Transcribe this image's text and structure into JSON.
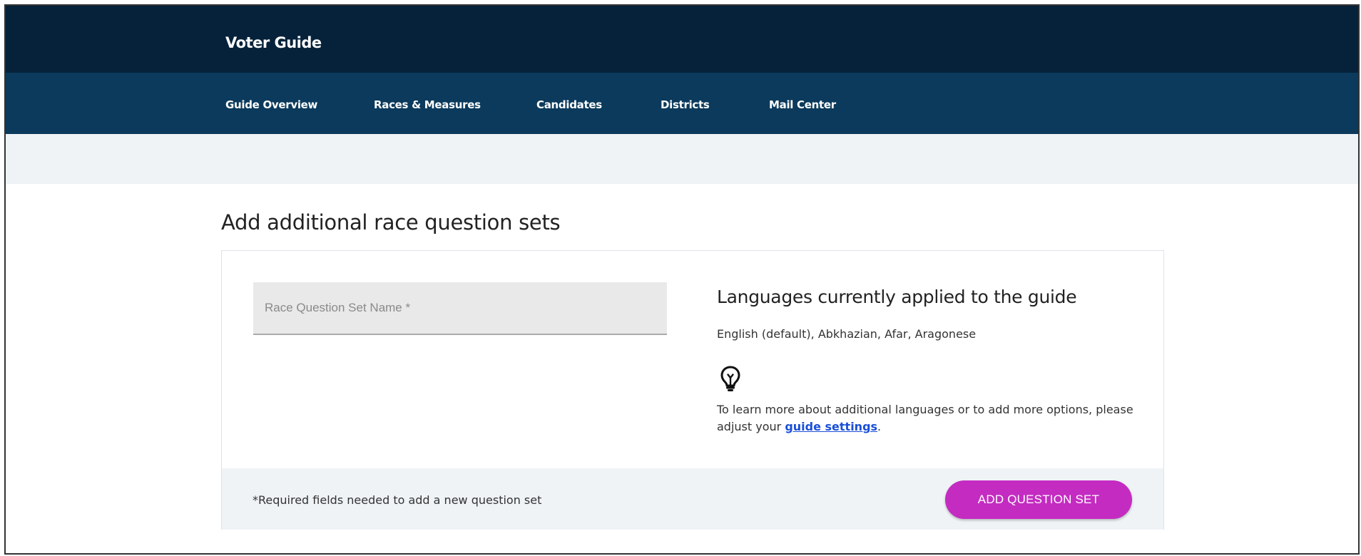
{
  "header": {
    "brand": "Voter Guide"
  },
  "nav": {
    "items": [
      {
        "label": "Guide Overview"
      },
      {
        "label": "Races & Measures"
      },
      {
        "label": "Candidates"
      },
      {
        "label": "Districts"
      },
      {
        "label": "Mail Center"
      }
    ]
  },
  "main": {
    "title": "Add additional race question sets",
    "form": {
      "name_placeholder": "Race Question Set Name *",
      "name_value": ""
    },
    "languages": {
      "heading": "Languages currently applied to the guide",
      "list": "English (default), Abkhazian, Afar, Aragonese",
      "icon": "lightbulb-icon",
      "tip_prefix": "To learn more about additional languages or to add more options, please adjust your ",
      "tip_link": "guide settings",
      "tip_suffix": "."
    },
    "footer": {
      "required_note": "*Required fields needed to add a new question set",
      "add_button": "ADD QUESTION SET"
    }
  },
  "colors": {
    "topbar": "#06223a",
    "navbar": "#0b3a5c",
    "accent": "#c42bc1",
    "link": "#1a4fd8"
  }
}
